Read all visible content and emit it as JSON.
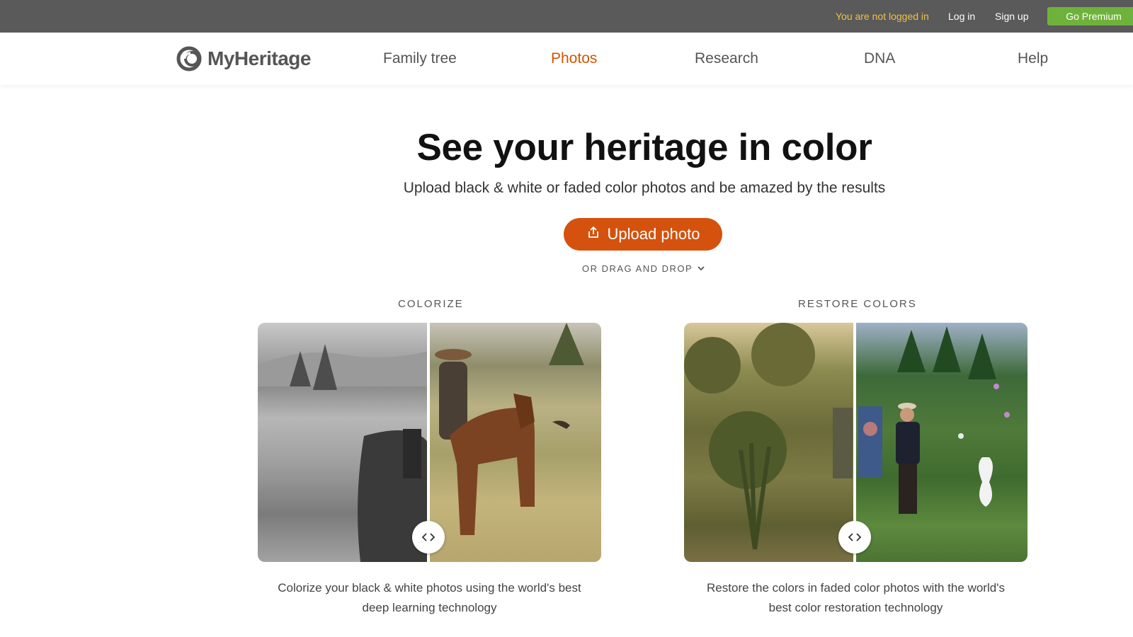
{
  "topbar": {
    "status": "You are not logged in",
    "login": "Log in",
    "signup": "Sign up",
    "premium": "Go Premium"
  },
  "nav": {
    "logo": "MyHeritage",
    "items": [
      "Family tree",
      "Photos",
      "Research",
      "DNA",
      "Help"
    ],
    "active": "Photos"
  },
  "hero": {
    "title": "See your heritage in color",
    "subtitle": "Upload black & white or faded color photos and be amazed by the results",
    "upload_label": "Upload photo",
    "drag_label": "OR DRAG AND DROP"
  },
  "colorize": {
    "label": "COLORIZE",
    "caption_line1": "Colorize your black & white photos using the world's best",
    "caption_line2": "deep learning technology"
  },
  "restore": {
    "label": "RESTORE COLORS",
    "caption_line1": "Restore the colors in faded color photos with the world's",
    "caption_line2": "best color restoration technology"
  },
  "colors": {
    "accent": "#d4520e",
    "active_nav": "#d35400",
    "premium": "#6fb23b",
    "topbar": "#5a5a5a"
  },
  "icons": [
    "logo-mark-icon",
    "upload-icon",
    "chevron-down-icon",
    "compare-arrows-icon"
  ]
}
